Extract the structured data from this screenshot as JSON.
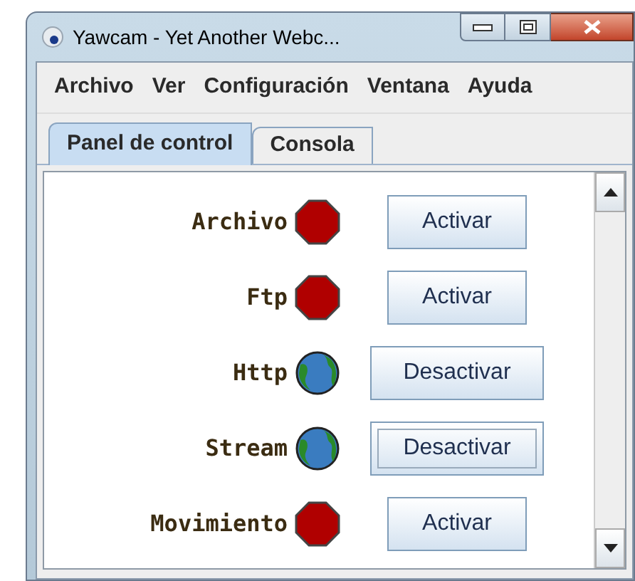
{
  "window": {
    "title": "Yawcam - Yet Another Webc..."
  },
  "menu": [
    "Archivo",
    "Ver",
    "Configuración",
    "Ventana",
    "Ayuda"
  ],
  "tabs": [
    {
      "label": "Panel de control",
      "selected": true
    },
    {
      "label": "Consola",
      "selected": false
    }
  ],
  "services": [
    {
      "name": "Archivo",
      "running": false,
      "button": "Activar",
      "focused": false
    },
    {
      "name": "Ftp",
      "running": false,
      "button": "Activar",
      "focused": false
    },
    {
      "name": "Http",
      "running": true,
      "button": "Desactivar",
      "focused": false
    },
    {
      "name": "Stream",
      "running": true,
      "button": "Desactivar",
      "focused": true
    },
    {
      "name": "Movimiento",
      "running": false,
      "button": "Activar",
      "focused": false
    }
  ]
}
